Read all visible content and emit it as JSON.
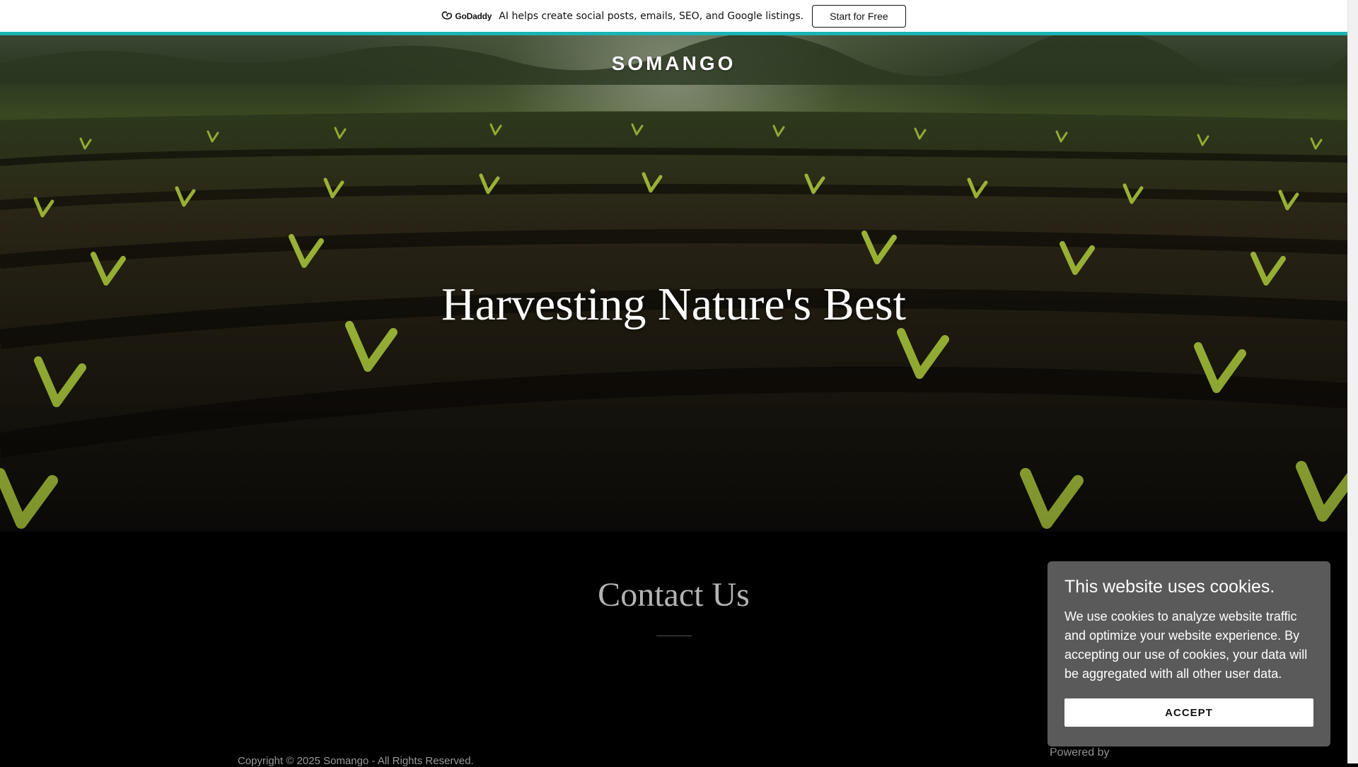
{
  "promo": {
    "logo_text": "GoDaddy",
    "message": "AI helps create social posts, emails, SEO, and Google listings.",
    "cta_label": "Start for Free",
    "accent_color": "#1bb3b3"
  },
  "header": {
    "brand": "SOMANGO"
  },
  "hero": {
    "title": "Harvesting Nature's Best"
  },
  "contact": {
    "title": "Contact Us"
  },
  "footer": {
    "copyright": "Copyright © 2025 Somango - All Rights Reserved.",
    "powered_by": "Powered by"
  },
  "cookie_banner": {
    "title": "This website uses cookies.",
    "body": "We use cookies to analyze website traffic and optimize your website experience. By accepting our use of cookies, your data will be aggregated with all other user data.",
    "accept_label": "ACCEPT",
    "background_color": "#5a5a5a"
  }
}
